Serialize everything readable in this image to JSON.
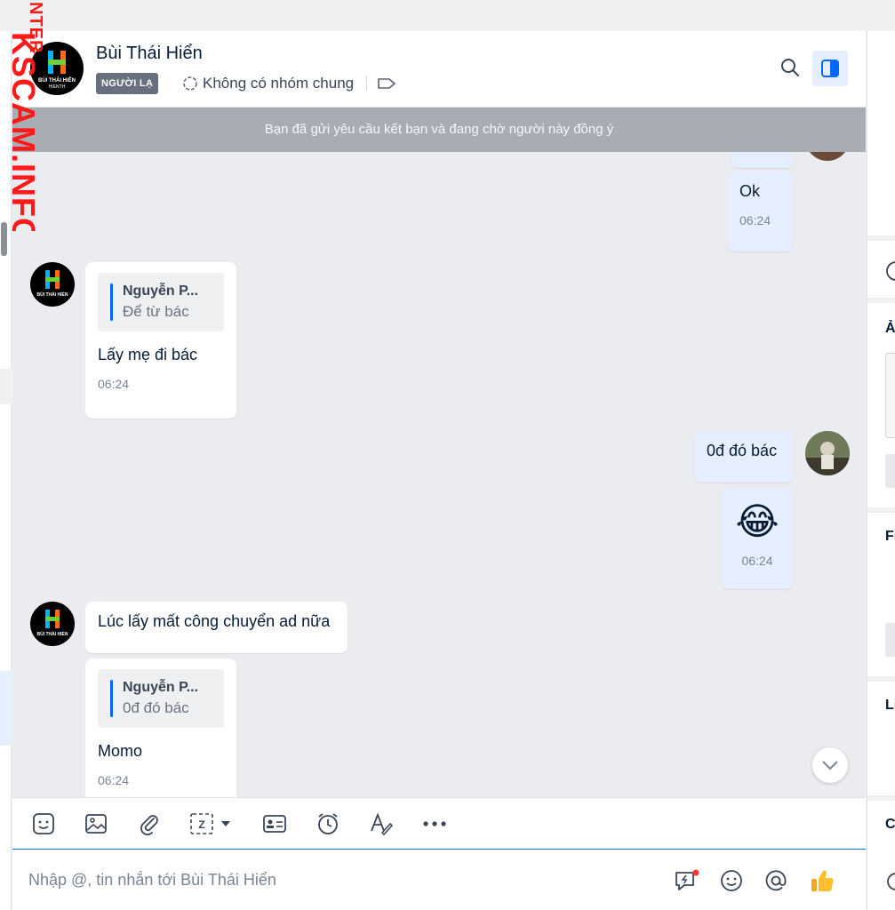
{
  "watermark": "KSCAM.INFO",
  "watermark_top": "NTER",
  "header": {
    "name": "Bùi Thái Hiển",
    "stranger_badge": "NGƯỜI LẠ",
    "groups": "Không có nhóm chung",
    "avatar_caption": "BÙI THÁI HIỂN",
    "avatar_sub": "HIENTH"
  },
  "banner": "Bạn đã gửi yêu cầu kết bạn và đang chờ người này đồng ý",
  "messages": [
    {
      "dir": "out",
      "text": "Ok",
      "time": "06:24"
    },
    {
      "dir": "in",
      "quote_name": "Nguyễn P...",
      "quote_text": "Để từ bác",
      "text": "Lấy mẹ đi bác",
      "time": "06:24"
    },
    {
      "dir": "out",
      "text": "0đ đó bác"
    },
    {
      "dir": "out",
      "emoji": "😂",
      "time": "06:24"
    },
    {
      "dir": "in",
      "text": "Lúc lấy mất công chuyển ad nữa"
    },
    {
      "dir": "in",
      "quote_name": "Nguyễn P...",
      "quote_text": "0đ đó bác",
      "text": "Momo",
      "time": "06:24"
    }
  ],
  "composer": {
    "placeholder": "Nhập @, tin nhắn tới Bùi Thái Hiển"
  },
  "right_pane": {
    "letters": [
      "Ả",
      "Fi",
      "Li",
      "C"
    ]
  },
  "colors": {
    "accent": "#0068ff",
    "outgoing_bubble": "#e5efff",
    "incoming_bubble": "#ffffff",
    "banner_bg": "#a8adb3",
    "watermark": "#ff0000"
  },
  "icons": [
    "search-icon",
    "sidebar-toggle-icon",
    "community-icon",
    "tag-icon",
    "sticker-icon",
    "image-icon",
    "attach-icon",
    "screenshot-icon",
    "business-card-icon",
    "reminder-icon",
    "format-text-icon",
    "more-icon",
    "quick-message-icon",
    "emoji-icon",
    "mention-icon",
    "thumbs-up-icon",
    "chevron-down-icon"
  ]
}
